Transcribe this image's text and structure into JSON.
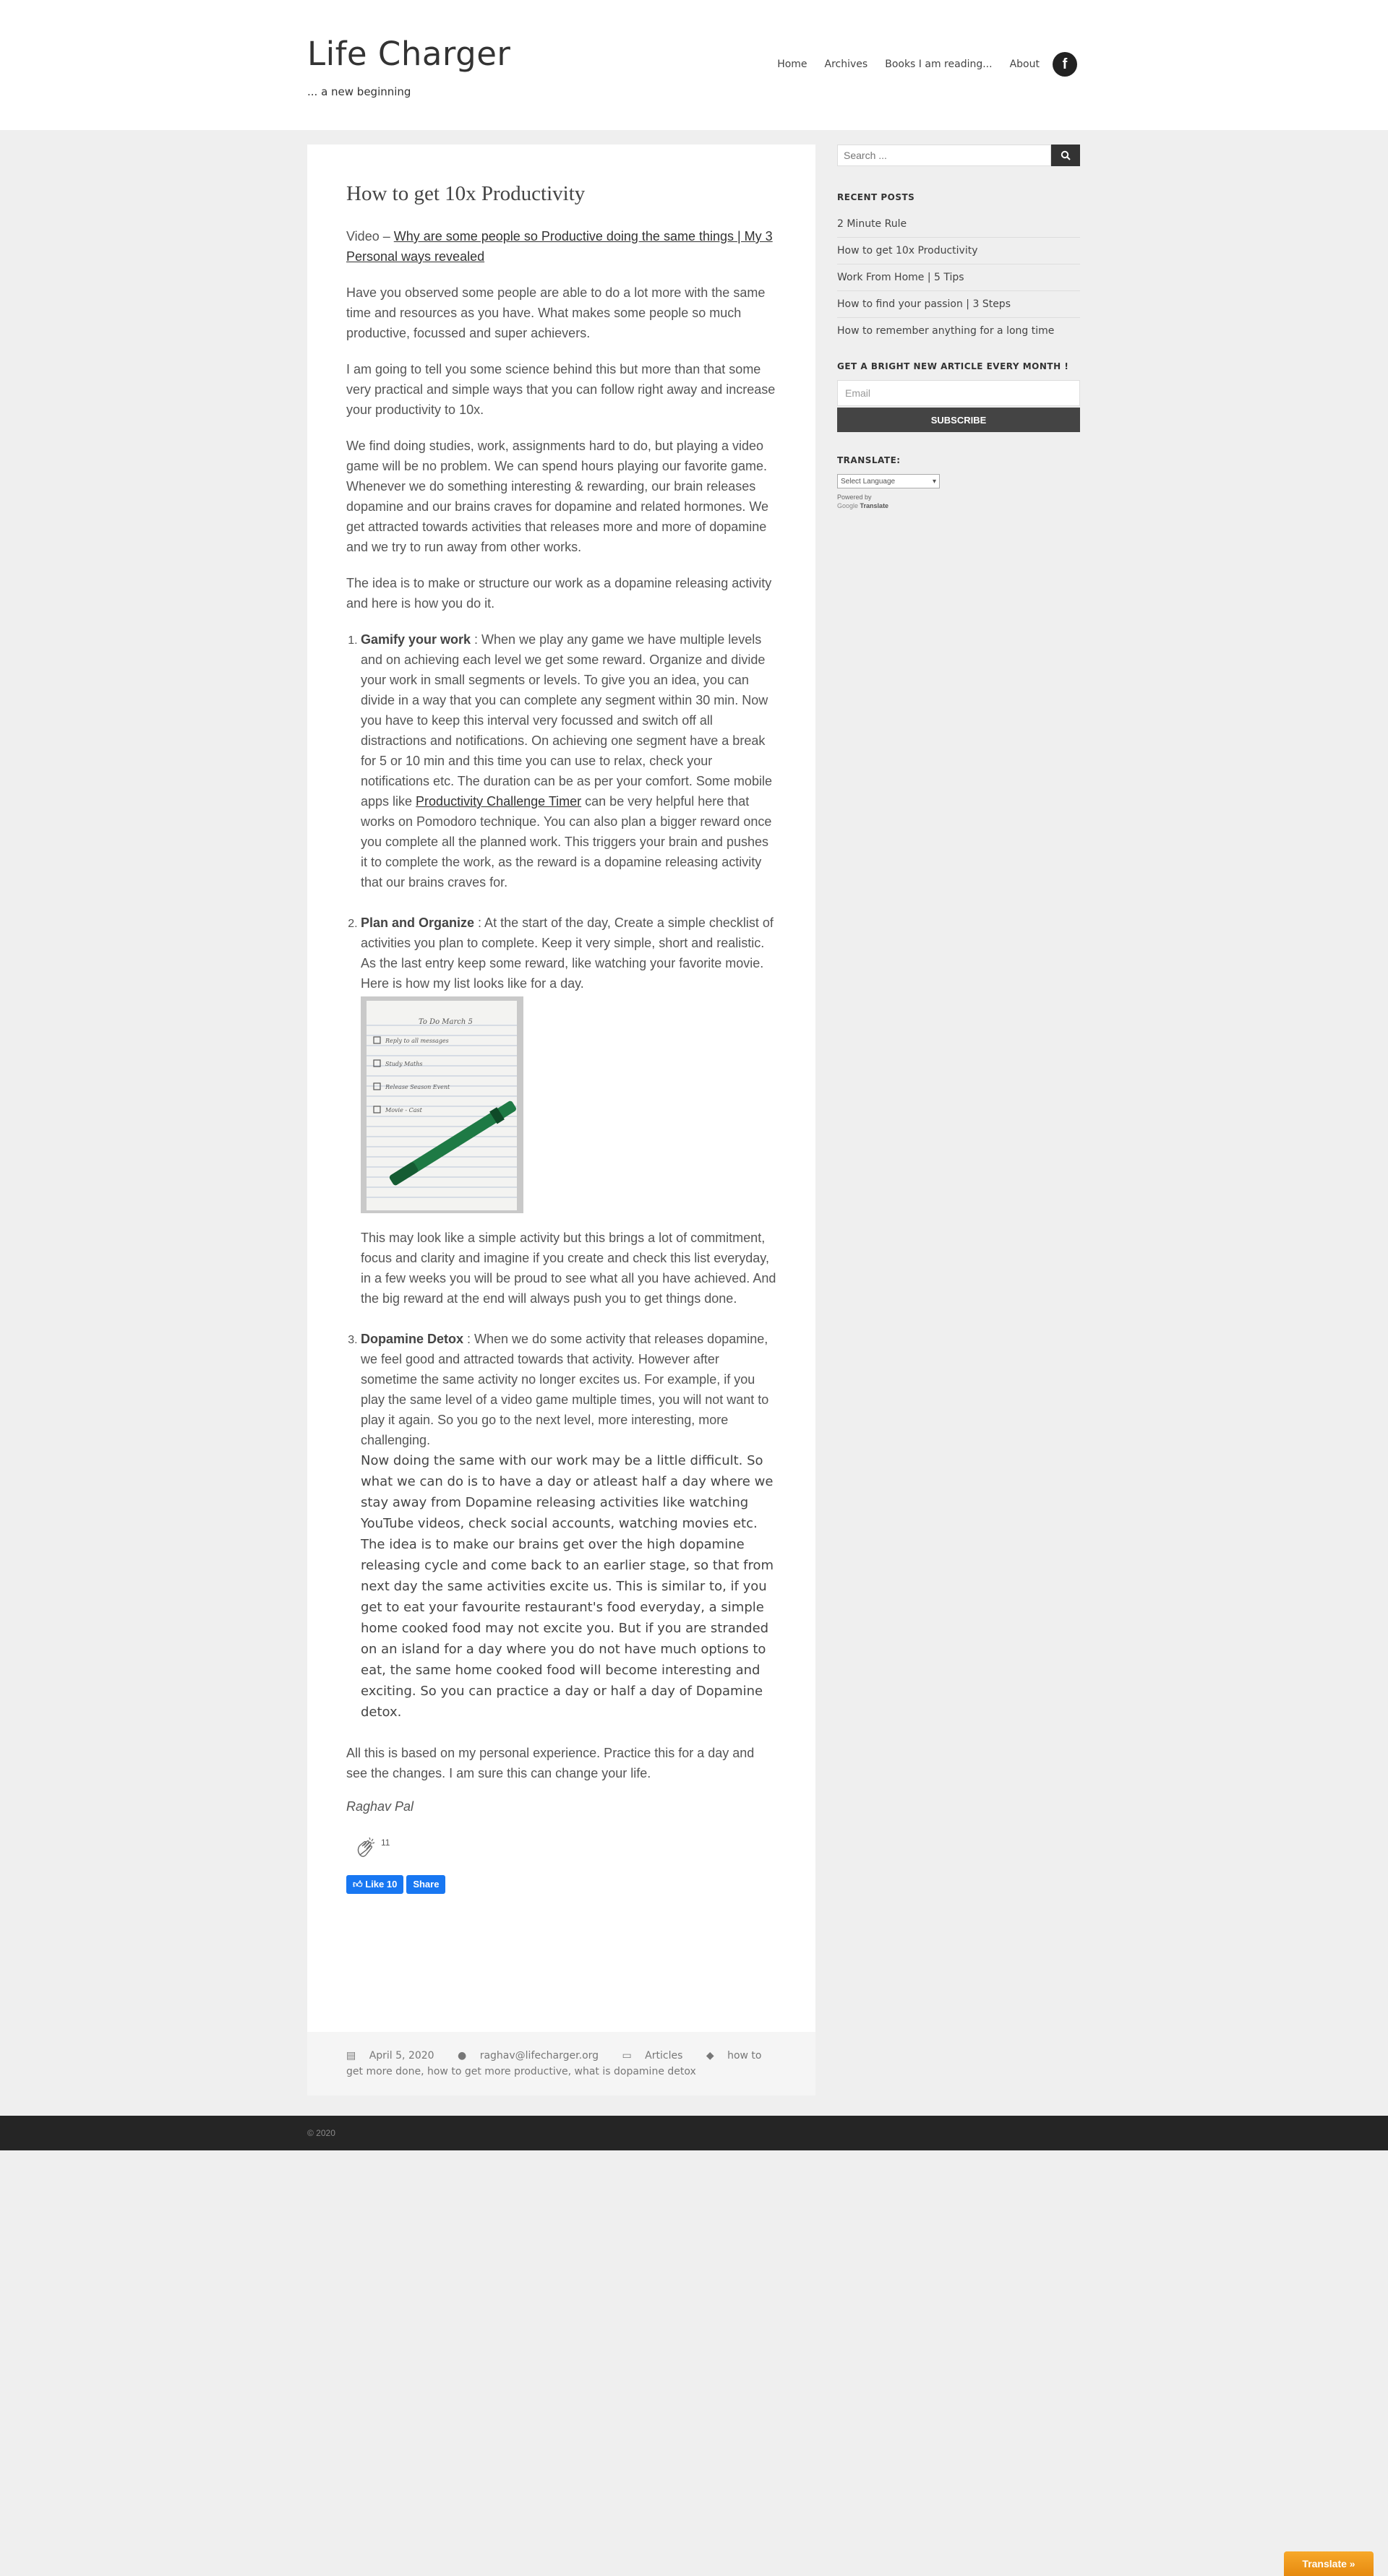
{
  "site": {
    "title": "Life Charger",
    "tagline": "... a new beginning"
  },
  "nav": {
    "items": [
      "Home",
      "Archives",
      "Books I am reading...",
      "About"
    ],
    "fb_glyph": "f"
  },
  "article": {
    "title": "How to get 10x Productivity",
    "video_prefix": "Video – ",
    "video_link": "Why are some people so Productive doing the same things | My 3 Personal ways revealed",
    "p1": "Have you observed some people are able to do a lot more with the same time and resources as you have. What makes some people so much productive, focussed and super achievers.",
    "p2": "I am going to tell you some science behind this but more than that some very practical and simple ways that you can follow right away and increase your productivity to 10x.",
    "p3a": "We find doing studies, work, assignments hard to do, but playing a video game will be no problem. We can spend hours playing our favorite game.",
    "p3b": "Whenever we do something interesting & rewarding, our brain releases dopamine and our brains craves for dopamine and related hormones. We get attracted towards activities that releases more and more of dopamine and we try to run away from other works.",
    "p4": "The idea is to make or structure our work as a dopamine releasing activity and here is how you do it.",
    "item1": {
      "heading": "Gamify your work",
      "text_before": " : When we play any game we have multiple levels and on achieving each level we get some reward. Organize and divide your work in small segments or levels. To give you an idea, you can divide in a way that you can complete any segment within 30 min. Now you have to keep this interval very focussed and switch off all distractions and notifications. On achieving one segment have a break for 5 or 10 min and this time you can use to relax, check your notifications etc. The duration can be as per your comfort. Some mobile apps like ",
      "link": "Productivity Challenge Timer",
      "text_after": " can be very helpful here that works on Pomodoro technique. You can also plan a bigger reward once you complete all the planned work. This triggers your brain and pushes it to complete the work, as the reward is a dopamine releasing activity that our brains craves for."
    },
    "item2": {
      "heading": "Plan and Organize",
      "text": " : At the start of the day, Create a simple checklist of activities you plan to complete. Keep it very simple, short and realistic. As the last entry keep some reward, like watching your favorite movie. Here is how my list looks like for a day.",
      "after_image": "This may look like a simple activity but this brings a lot of commitment, focus and clarity and imagine if you create and check this list everyday, in a few weeks you will be proud to see what all you have achieved. And the big reward at the end will always push you to get things done."
    },
    "item3": {
      "heading": "Dopamine Detox",
      "text": " : When we do some activity that releases dopamine, we feel good and attracted towards that activity. However after sometime the same activity no longer excites us. For example, if you play the same level of a video game multiple times, you will not want to play it again. So you go to the next level, more interesting, more challenging.",
      "text2": "Now doing the same with our work may be a little difficult. So what we can do is to have a day or atleast half a day where we stay away from Dopamine releasing activities like watching YouTube videos, check social accounts, watching movies etc. The idea is to make our brains get over the high dopamine releasing cycle and come back to an earlier stage, so that from next day the same activities excite us. This is similar to, if you get to eat your favourite restaurant's food everyday, a simple home cooked food may not excite you. But if you are stranded on an island for a day where you do not have much options to eat, the same home cooked food will become interesting and exciting.  So you can practice a day or half a day of Dopamine detox."
    },
    "closing": "All this is based on my personal experience. Practice this for a day and see the changes. I am sure this can change your life.",
    "signature": "Raghav Pal",
    "claps": "11",
    "like_label": "Like 10",
    "share_label": "Share",
    "note_lines": [
      "To Do   March 5",
      "Reply to all messages",
      "Study Maths",
      "Release Season Event",
      "Movie - Cast"
    ]
  },
  "meta": {
    "date": "April 5, 2020",
    "author": "raghav@lifecharger.org",
    "category": "Articles",
    "tags": "how to get more done, how to get more productive, what is dopamine detox"
  },
  "sidebar": {
    "search_placeholder": "Search ...",
    "recent_title": "RECENT POSTS",
    "recent": [
      "2 Minute Rule",
      "How to get 10x Productivity",
      "Work From Home | 5 Tips",
      "How to find your passion | 3 Steps",
      "How to remember anything for a long time"
    ],
    "subscribe_title": "GET A BRIGHT NEW ARTICLE EVERY MONTH !",
    "email_placeholder": "Email",
    "subscribe_label": "SUBSCRIBE",
    "translate_title": "TRANSLATE:",
    "select_language": "Select Language",
    "powered_by": "Powered by",
    "google": "Google",
    "translate_word": "Translate"
  },
  "footer": {
    "copyright": "© 2020"
  },
  "translate_button": "Translate »"
}
